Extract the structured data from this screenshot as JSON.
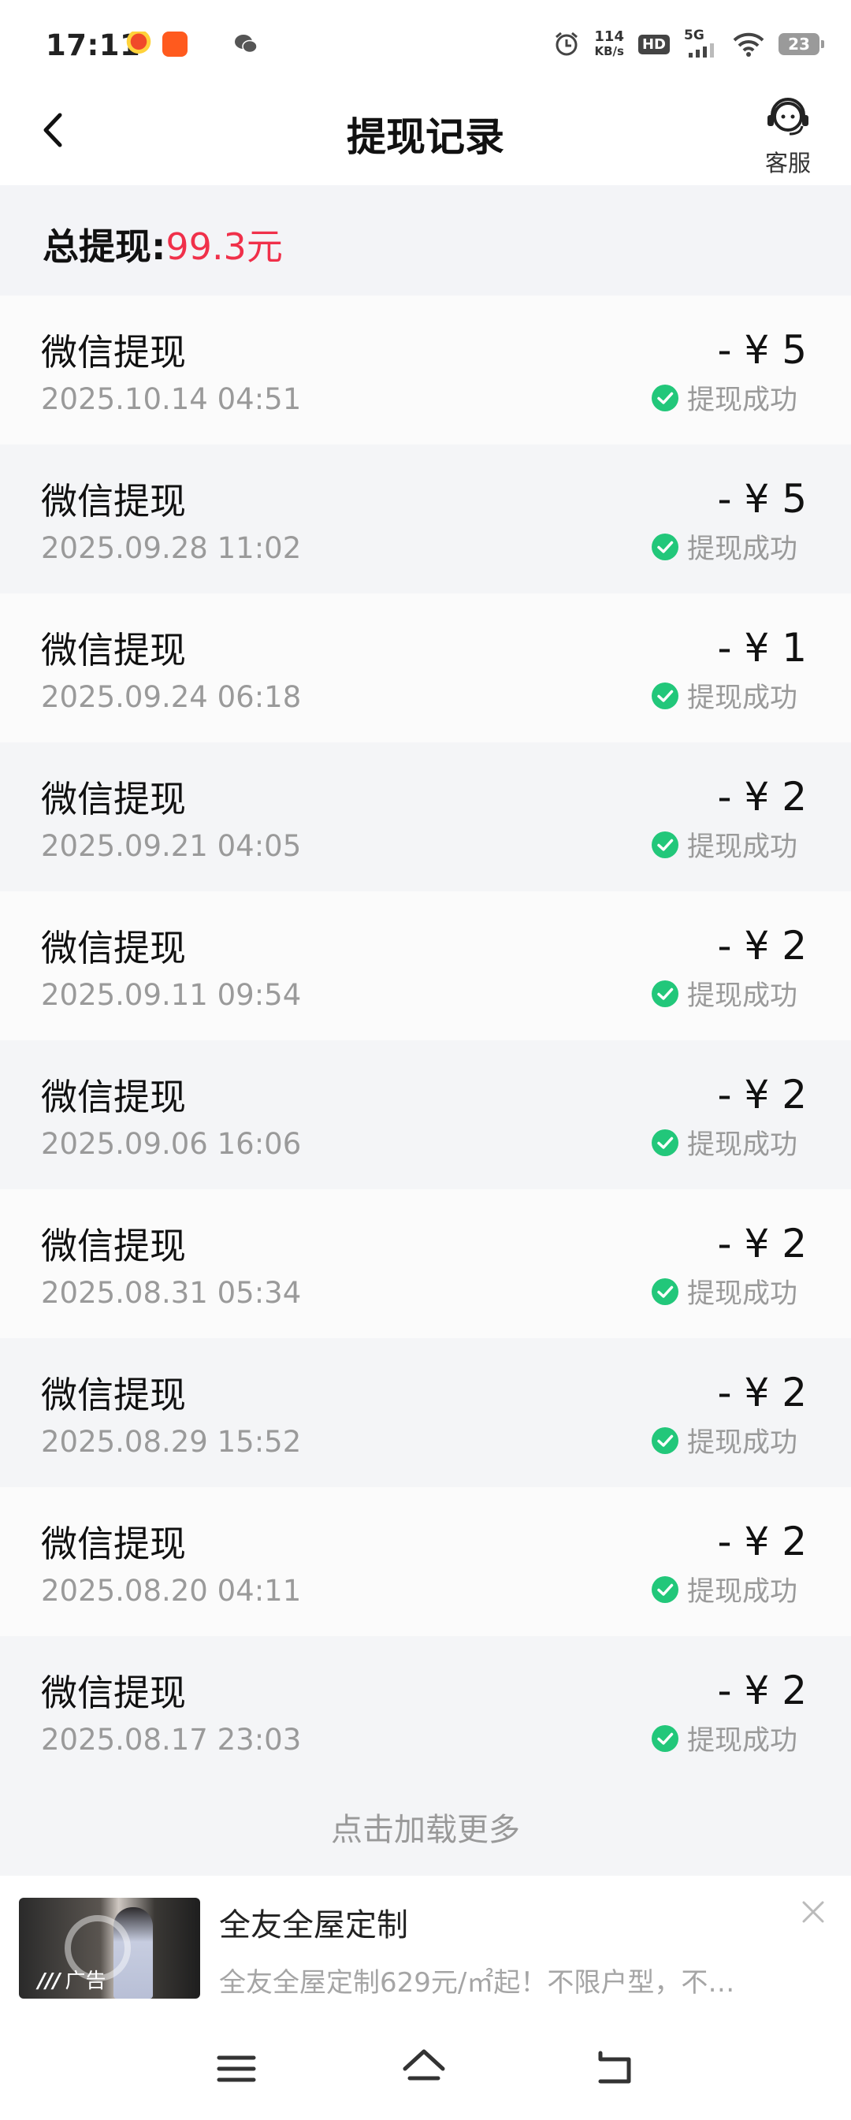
{
  "status_bar": {
    "time": "17:11",
    "net_speed_top": "114",
    "net_speed_bottom": "KB/s",
    "hd": "HD",
    "signal": "5G",
    "battery": "23"
  },
  "header": {
    "title": "提现记录",
    "service_label": "客服"
  },
  "summary": {
    "label": "总提现:",
    "amount": "99.3元"
  },
  "records": [
    {
      "title": "微信提现",
      "date": "2025.10.14 04:51",
      "amount": "- ¥ 5",
      "status": "提现成功"
    },
    {
      "title": "微信提现",
      "date": "2025.09.28 11:02",
      "amount": "- ¥ 5",
      "status": "提现成功"
    },
    {
      "title": "微信提现",
      "date": "2025.09.24 06:18",
      "amount": "- ¥ 1",
      "status": "提现成功"
    },
    {
      "title": "微信提现",
      "date": "2025.09.21 04:05",
      "amount": "- ¥ 2",
      "status": "提现成功"
    },
    {
      "title": "微信提现",
      "date": "2025.09.11 09:54",
      "amount": "- ¥ 2",
      "status": "提现成功"
    },
    {
      "title": "微信提现",
      "date": "2025.09.06 16:06",
      "amount": "- ¥ 2",
      "status": "提现成功"
    },
    {
      "title": "微信提现",
      "date": "2025.08.31 05:34",
      "amount": "- ¥ 2",
      "status": "提现成功"
    },
    {
      "title": "微信提现",
      "date": "2025.08.29 15:52",
      "amount": "- ¥ 2",
      "status": "提现成功"
    },
    {
      "title": "微信提现",
      "date": "2025.08.20 04:11",
      "amount": "- ¥ 2",
      "status": "提现成功"
    },
    {
      "title": "微信提现",
      "date": "2025.08.17 23:03",
      "amount": "- ¥ 2",
      "status": "提现成功"
    }
  ],
  "load_more": "点击加载更多",
  "ad": {
    "title": "全友全屋定制",
    "description": "全友全屋定制629元/㎡起！不限户型，不…",
    "badge": "广告"
  },
  "colors": {
    "accent_red": "#f0304a",
    "success_green": "#22c77a"
  }
}
